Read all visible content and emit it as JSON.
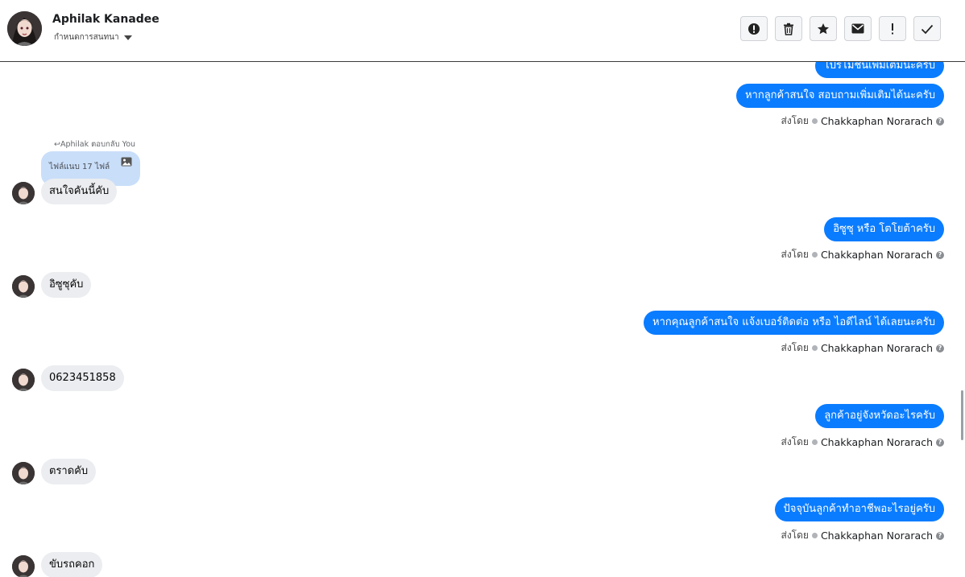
{
  "header": {
    "name": "Aphilak Kanadee",
    "subtitle": "กำหนดการสนทนา",
    "actions": [
      "alert-circle-icon",
      "trash-icon",
      "star-icon",
      "mail-icon",
      "exclamation-icon",
      "check-icon"
    ]
  },
  "messages": {
    "out1": "โปรโมชั่นเพิ่มเติมนะครับ",
    "out2": "หากลูกค้าสนใจ สอบถามเพิ่มเติมได้นะครับ",
    "reply_note": "Aphilak ตอบกลับ You",
    "reply_text": "ไฟล์แนบ 17 ไฟล์",
    "in1": "สนใจคันนี้คับ",
    "out3": "อิซูซุ หรือ โตโยต้าครับ",
    "in2": "อิซูซุคับ",
    "out4": "หากคุณลูกค้าสนใจ แจ้งเบอร์ติดต่อ หรือ ไอดีไลน์ ได้เลยนะครับ",
    "in3": "0623451858",
    "out5": "ลูกค้าอยู่จังหวัดอะไรครับ",
    "in4": "ตราดคับ",
    "out6": "ปัจจุบันลูกค้าทำอาชีพอะไรอยู่ครับ",
    "in5": "ขับรถคอก"
  },
  "sent_by": {
    "label": "ส่งโดย",
    "name": "Chakkaphan Norarach"
  },
  "colors": {
    "outgoing": "#0a7cff",
    "incoming": "#ebedf0",
    "reply_bubble": "#c9def9"
  }
}
